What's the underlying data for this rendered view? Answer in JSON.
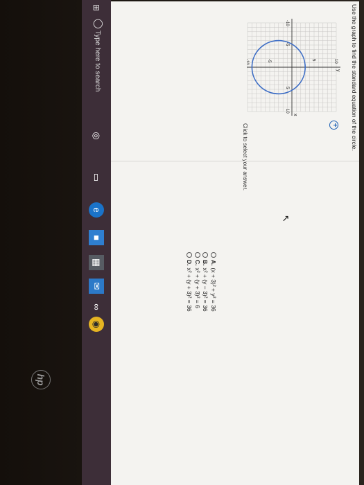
{
  "question": "Use the graph to find the standard equation of the circle.",
  "prompt": "Click to select your answer.",
  "graph": {
    "x_label": "x",
    "y_label": "y",
    "tick_labels": {
      "x": [
        "-10",
        "-5",
        "5",
        "10"
      ],
      "y": [
        "10",
        "5",
        "-5",
        "-10"
      ]
    },
    "circle": {
      "center": [
        0,
        -3
      ],
      "radius": 6
    },
    "range": [
      -10,
      10
    ],
    "circle_color": "#3b6cc5"
  },
  "choices": [
    {
      "letter": "A.",
      "text": "(x + 3)² + y² = 36"
    },
    {
      "letter": "B.",
      "text": "x² + (y − 3)² = 36"
    },
    {
      "letter": "C.",
      "text": "x² + (y + 3)² = 6"
    },
    {
      "letter": "D.",
      "text": "x² + (y + 3)² = 36"
    }
  ],
  "taskbar": {
    "search_placeholder": "Type here to search"
  },
  "brand": "hp"
}
